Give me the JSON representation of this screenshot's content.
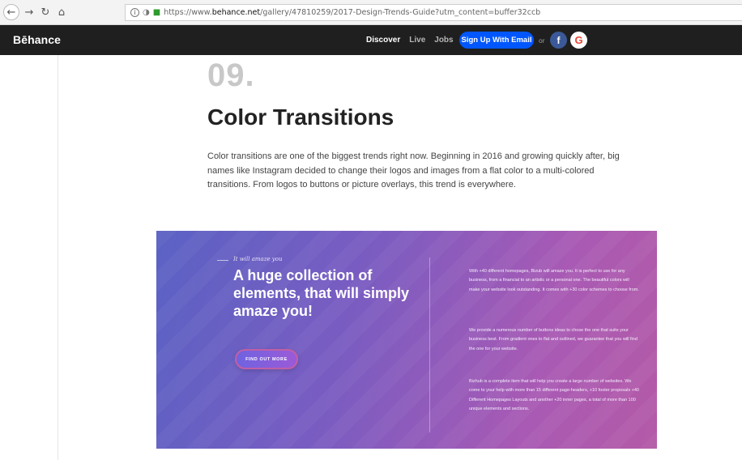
{
  "browser": {
    "url_prefix": "https://www.",
    "url_host": "behance.net",
    "url_path": "/gallery/47810259/2017-Design-Trends-Guide?utm_content=buffer32ccb"
  },
  "nav": {
    "logo": "Bēhance",
    "links": [
      "Discover",
      "Live",
      "Jobs"
    ],
    "signup": "Sign Up With Email",
    "or": "or",
    "facebook": "f",
    "google": "G"
  },
  "article": {
    "number": "09.",
    "heading": "Color Transitions",
    "paragraph": "Color transitions are one of the biggest trends right now.  Beginning in 2016 and growing quickly  after, big names like Instagram decided to change their logos and images from a flat color to a multi-colored transitions. From logos to buttons or picture overlays, this trend is everywhere."
  },
  "hero": {
    "tagline": "It will amaze you",
    "title": "A huge collection of elements, that will simply amaze you!",
    "button": "FIND OUT MORE",
    "text1": "With +40 different homepages, Bizub will amaze you. It is perfect to use for any business, from a financial to an artistic or a personal one. The beautiful colors will make your website look outstanding. It comes with +30 color schemes to choose from.",
    "text2": "We provide a numerous number of buttons ideas to chose the one that suits your business best. From gradient ones to flat and outlined, we guarantee that you will find the one for your website.",
    "text3": "Bizhub is a complete item that will help you create a large number of websites. We come to your help with more than 15 different page-headers, +10 footer proposals +40 Different Homepages Layouts and another +20 inner pages, a total of more than 100 unique elements and sections."
  },
  "colors": {
    "nav_bg": "#1f1f1f",
    "signup_bg": "#0057ff",
    "hero_start": "#5b62c4",
    "hero_end": "#b45aa7"
  },
  "icons": [
    "back-arrow-icon",
    "forward-arrow-icon",
    "reload-icon",
    "home-icon",
    "info-icon",
    "shield-icon",
    "lock-icon"
  ]
}
